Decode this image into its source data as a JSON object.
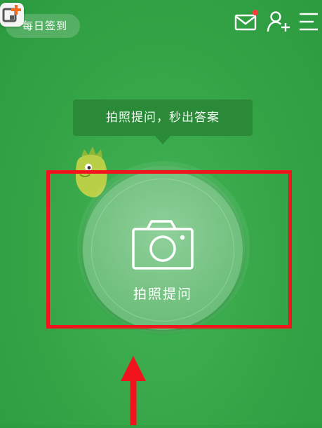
{
  "header": {
    "checkin_label": "每日签到",
    "has_unread_mail": true,
    "icons": [
      "app-badge-icon",
      "mail-icon",
      "person-add-icon",
      "menu-icon"
    ]
  },
  "tooltip": {
    "text": "拍照提问，秒出答案"
  },
  "camera_button": {
    "label": "拍照提问",
    "icon": "camera-icon"
  },
  "colors": {
    "background": "#35a447",
    "accent_dark": "#2a8a38",
    "annotation": "#f2141c",
    "notification_dot": "#ff3b3b"
  }
}
